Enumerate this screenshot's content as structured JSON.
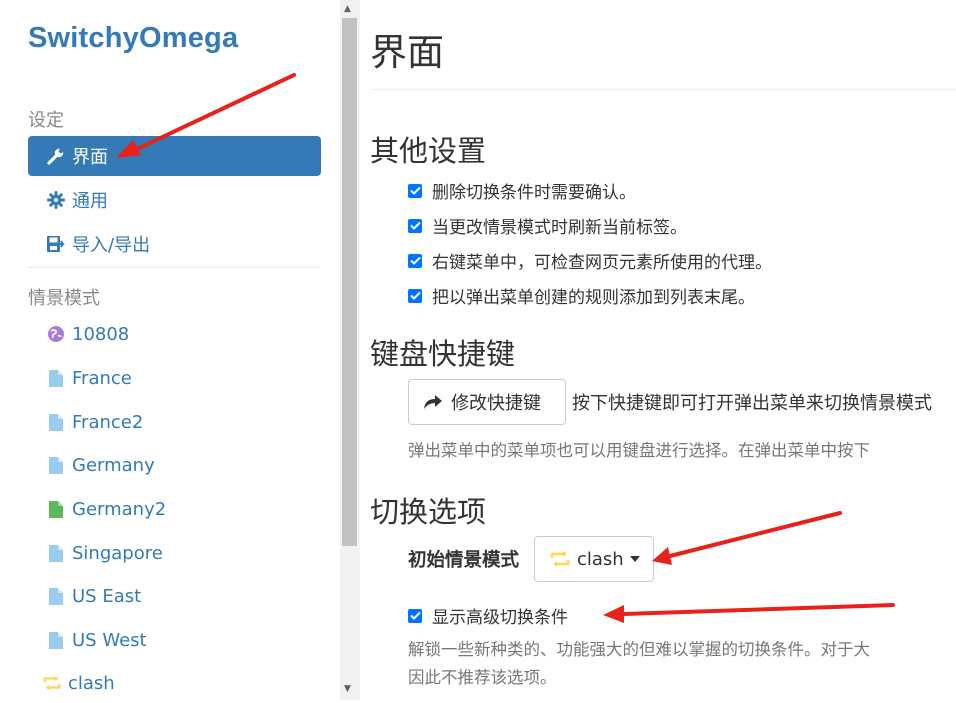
{
  "app": {
    "brand": "SwitchyOmega"
  },
  "sidebar": {
    "settings_header": "设定",
    "settings_items": [
      {
        "label": "界面",
        "icon": "wrench-icon",
        "active": true
      },
      {
        "label": "通用",
        "icon": "gear-icon"
      },
      {
        "label": "导入/导出",
        "icon": "import-export-icon"
      }
    ],
    "profiles_header": "情景模式",
    "profiles": [
      {
        "label": "10808",
        "icon": "globe-icon",
        "color": "#a87bd8"
      },
      {
        "label": "France",
        "icon": "file-icon",
        "color": "#99ccee"
      },
      {
        "label": "France2",
        "icon": "file-icon",
        "color": "#99ccee"
      },
      {
        "label": "Germany",
        "icon": "file-icon",
        "color": "#99ccee"
      },
      {
        "label": "Germany2",
        "icon": "file-icon",
        "color": "#5cb85c"
      },
      {
        "label": "Singapore",
        "icon": "file-icon",
        "color": "#99ccee"
      },
      {
        "label": "US East",
        "icon": "file-icon",
        "color": "#99ccee"
      },
      {
        "label": "US West",
        "icon": "file-icon",
        "color": "#99ccee"
      },
      {
        "label": "clash",
        "icon": "switch-icon",
        "color": "#ffd84d"
      }
    ]
  },
  "main": {
    "title": "界面",
    "other_settings": {
      "heading": "其他设置",
      "checkboxes": [
        {
          "label": "删除切换条件时需要确认。",
          "checked": true
        },
        {
          "label": "当更改情景模式时刷新当前标签。",
          "checked": true
        },
        {
          "label": "右键菜单中，可检查网页元素所使用的代理。",
          "checked": true
        },
        {
          "label": "把以弹出菜单创建的规则添加到列表末尾。",
          "checked": true
        }
      ]
    },
    "shortcuts": {
      "heading": "键盘快捷键",
      "button_label": "修改快捷键",
      "description": "按下快捷键即可打开弹出菜单来切换情景模式",
      "help": "弹出菜单中的菜单项也可以用键盘进行选择。在弹出菜单中按下"
    },
    "switch_options": {
      "heading": "切换选项",
      "initial_profile_label": "初始情景模式",
      "initial_profile_value": "clash",
      "advanced_checkbox": {
        "label": "显示高级切换条件",
        "checked": true
      },
      "help_line1": "解锁一些新种类的、功能强大的但难以掌握的切换条件。对于大",
      "help_line2": "因此不推荐该选项。"
    }
  },
  "colors": {
    "accent": "#337ab7",
    "checkbox": "#0075ff",
    "annotation": "#e8221a"
  }
}
